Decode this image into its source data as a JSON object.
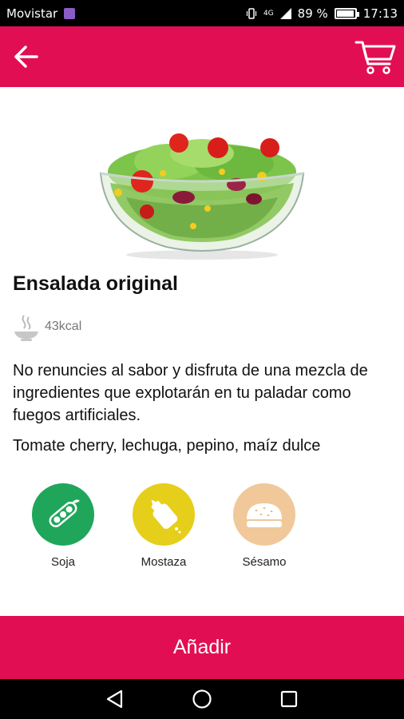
{
  "status_bar": {
    "carrier": "Movistar",
    "network": "4G",
    "battery": "89 %",
    "battery_level": 0.89,
    "time": "17:13"
  },
  "app_bar": {
    "back_icon": "arrow-left-icon",
    "cart_icon": "shopping-cart-icon"
  },
  "product": {
    "image": "salad-bowl-image",
    "title": "Ensalada original",
    "kcal": "43kcal",
    "kcal_icon": "steaming-bowl-icon",
    "description": "No renuncies al sabor y disfruta de una mezcla de ingredientes que explotarán en tu paladar como fuegos artificiales.",
    "ingredients": "Tomate cherry, lechuga, pepino, maíz dulce"
  },
  "allergens": [
    {
      "label": "Soja",
      "icon": "soy-pod-icon",
      "color": "#1fa65a"
    },
    {
      "label": "Mostaza",
      "icon": "mustard-bottle-icon",
      "color": "#e6cf1a"
    },
    {
      "label": "Sésamo",
      "icon": "sesame-bun-icon",
      "color": "#f0c89a"
    }
  ],
  "actions": {
    "add_label": "Añadir"
  },
  "colors": {
    "primary": "#e20e54"
  },
  "nav_bar": {
    "back": "triangle-back-icon",
    "home": "circle-home-icon",
    "recents": "square-recents-icon"
  }
}
